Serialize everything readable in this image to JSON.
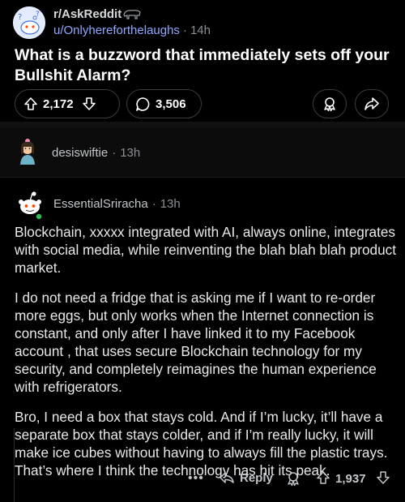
{
  "post": {
    "subreddit": "r/AskReddit",
    "author": "u/Onlyhereforthelaughs",
    "separator": "·",
    "time": "14h",
    "title": "What is a buzzword that immediately sets off your Bullshit Alarm?",
    "upvotes": "2,172",
    "comments": "3,506"
  },
  "collapsed_comment": {
    "author": "desiswiftie",
    "separator": "·",
    "time": "13h"
  },
  "comment": {
    "author": "EssentialSriracha",
    "separator": "·",
    "time": "13h",
    "paragraphs": [
      "Blockchain, xxxxx integrated with AI, always online, integrates with social media, while reinventing the blah blah blah product market.",
      "I do not need a fridge that is asking me if I want to re-order more eggs, but only works when the Internet connection is constant, and only after I have linked it to my Facebook account , that uses secure Blockchain technology for my security, and completely reimagines the human experience with refrigerators.",
      "Bro, I need a box that stays cold. And if I’m lucky, it’ll have a separate box that stays colder, and if I’m really lucky, it will make ice cubes without having to always fill the plastic trays. That’s where I think the technology has hit its peak."
    ],
    "more_label": "•••",
    "reply_label": "Reply",
    "score": "1,937"
  },
  "icons": {
    "upvote": "arrow-up-icon",
    "downvote": "arrow-down-icon",
    "comment": "speech-bubble-icon",
    "award": "award-icon",
    "share": "share-icon",
    "reply": "reply-arrow-icon"
  },
  "colors": {
    "background": "#000000",
    "username_link": "#8fa8ff",
    "muted": "#8b8f93",
    "online": "#2fbd5a"
  }
}
